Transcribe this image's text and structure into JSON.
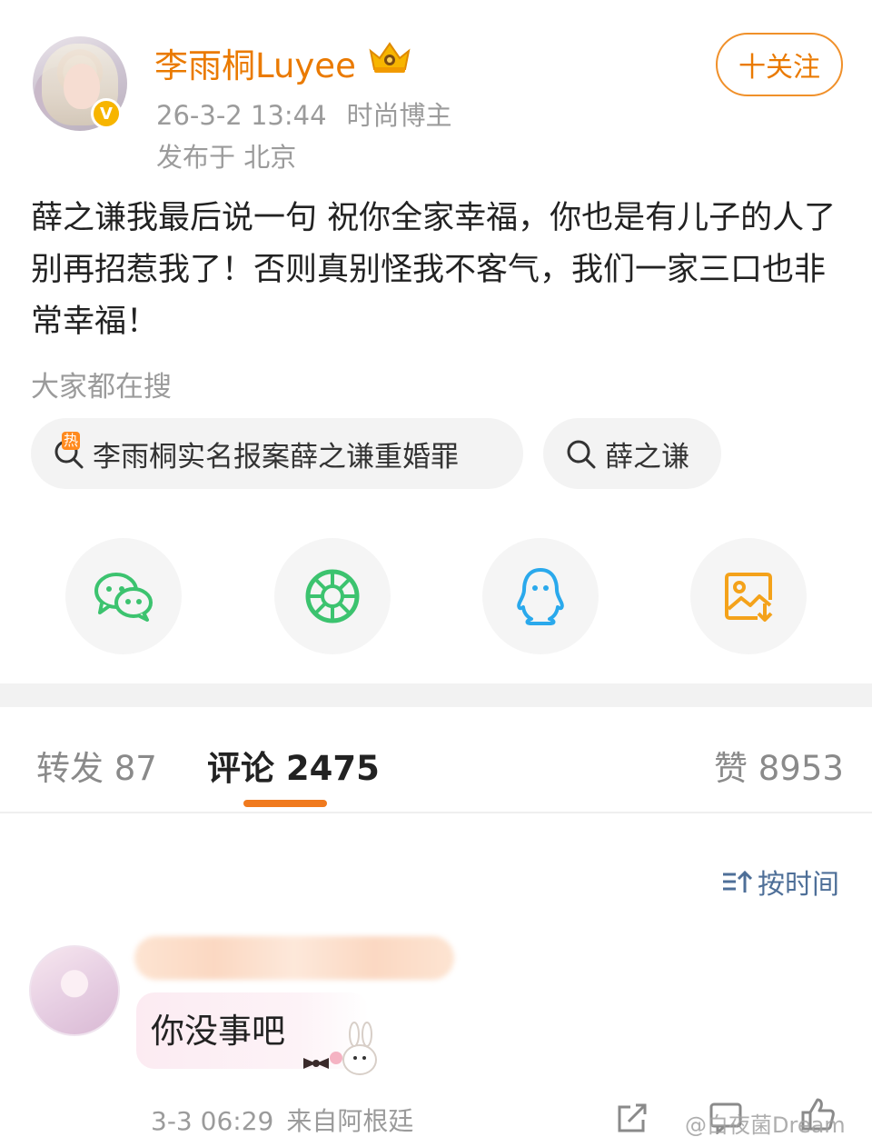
{
  "post": {
    "username": "李雨桐Luyee",
    "timestamp": "26-3-2 13:44",
    "user_tag": "时尚博主",
    "location": "发布于 北京",
    "follow_label": "十关注",
    "content": "薛之谦我最后说一句 祝你全家幸福，你也是有儿子的人了别再招惹我了！否则真别怪我不客气，我们一家三口也非常幸福！",
    "verified_badge": "V"
  },
  "search": {
    "title": "大家都在搜",
    "hot_badge": "热",
    "chips": [
      {
        "label": "李雨桐实名报案薛之谦重婚罪",
        "icon": "hot-search-icon"
      },
      {
        "label": "薛之谦",
        "icon": "search-icon"
      }
    ]
  },
  "share": [
    {
      "icon": "wechat-icon",
      "color": "#3cc36f"
    },
    {
      "icon": "moments-icon",
      "color": "#3cc36f"
    },
    {
      "icon": "qq-icon",
      "color": "#2aa9ec"
    },
    {
      "icon": "save-image-icon",
      "color": "#f4a21a"
    }
  ],
  "tabs": {
    "reposts": "转发 87",
    "comments": "评论 2475",
    "likes": "赞 8953"
  },
  "sort_label": "按时间",
  "comment": {
    "text": "你没事吧",
    "timestamp": "3-3 06:29",
    "source": "来自阿根廷"
  },
  "watermark": "@白夜菌Dream",
  "colors": {
    "accent": "#ea7a00",
    "link": "#4e6f98",
    "muted": "#9b9b9b"
  }
}
